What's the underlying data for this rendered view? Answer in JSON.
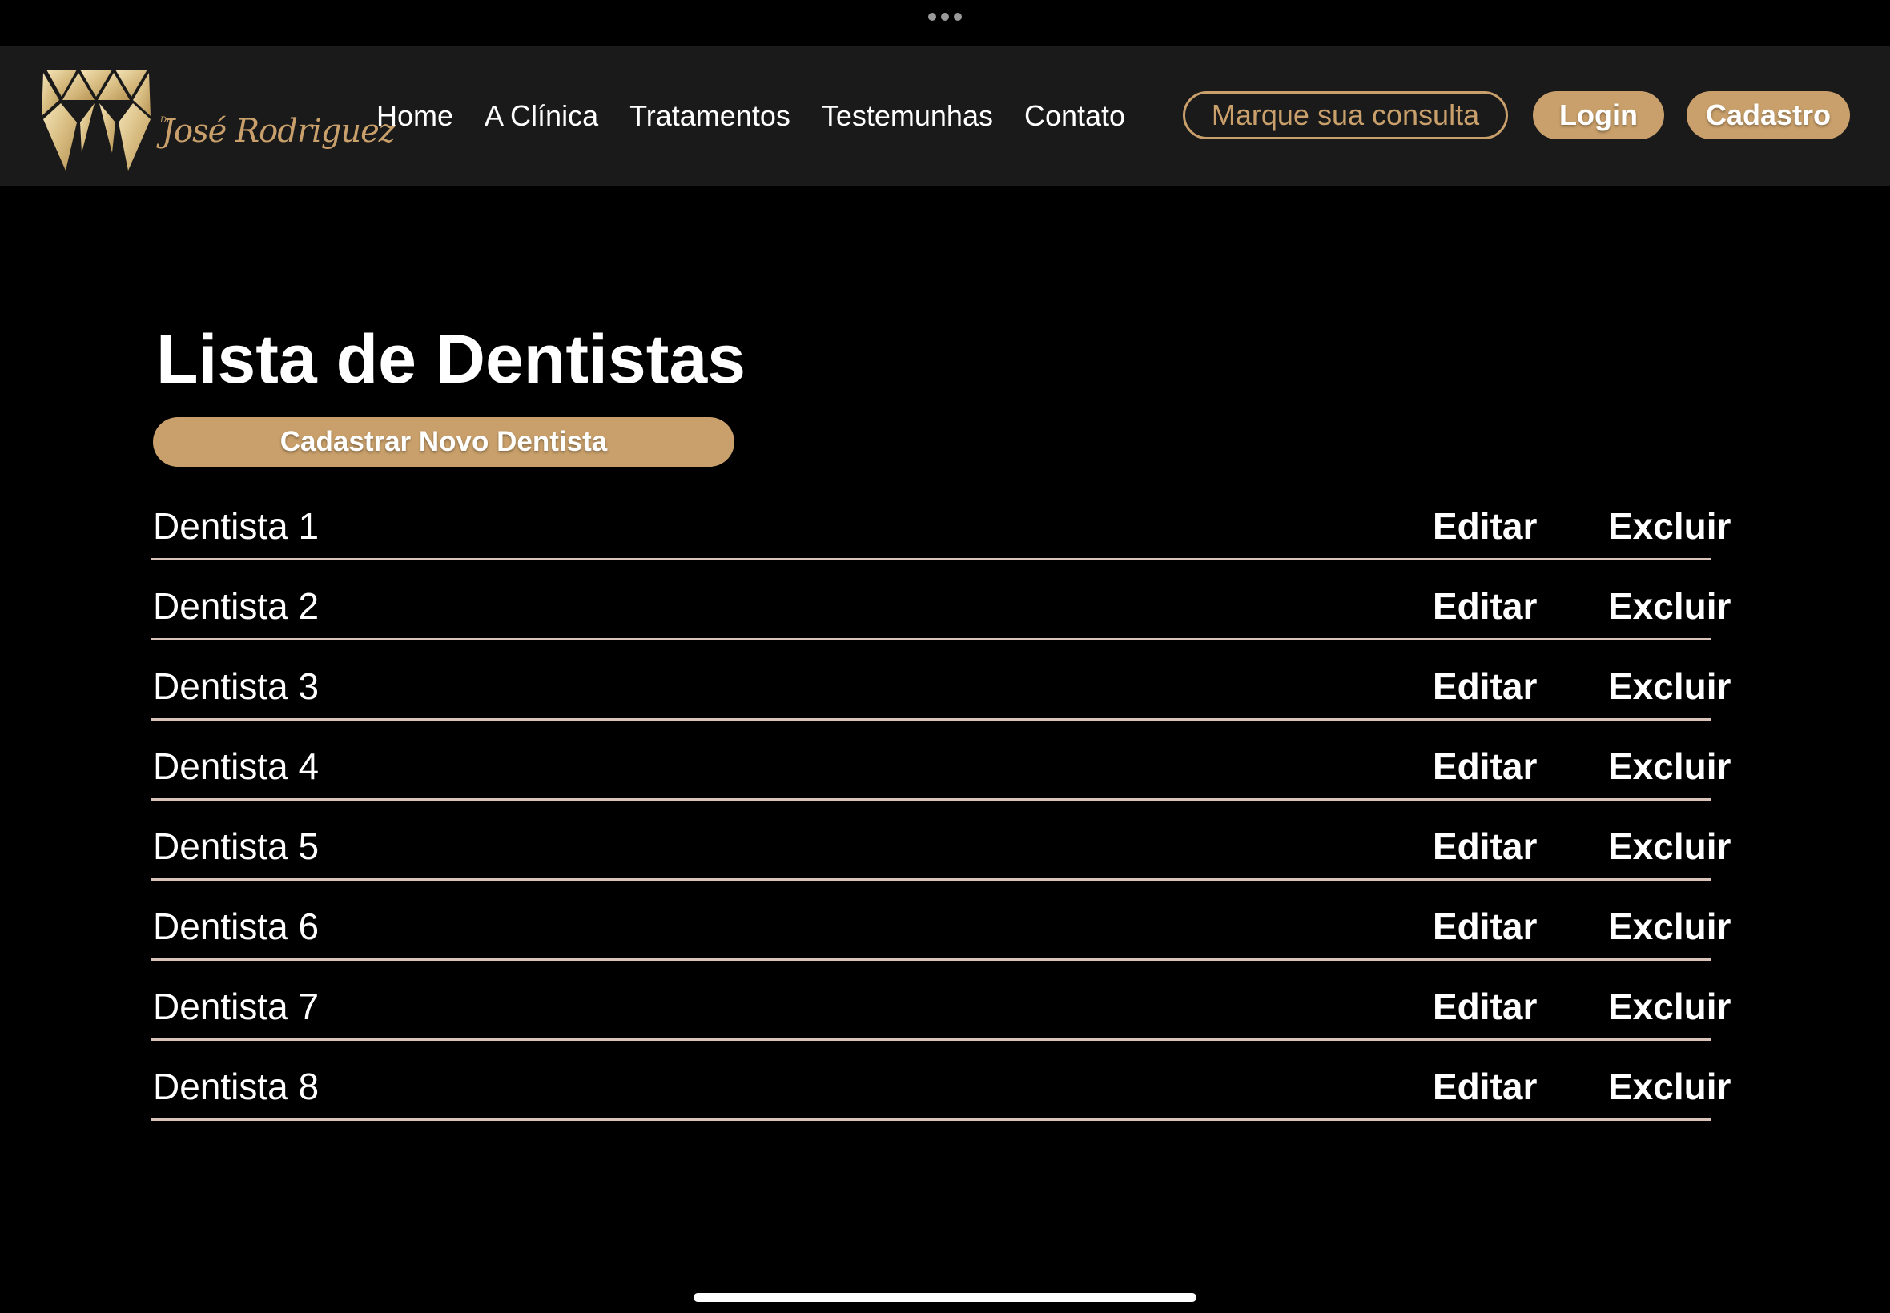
{
  "brand": {
    "prefix": "Dr.",
    "name": "José Rodriguez",
    "accent_color": "#c9a06b"
  },
  "nav": {
    "links": [
      {
        "label": "Home"
      },
      {
        "label": "A Clínica"
      },
      {
        "label": "Tratamentos"
      },
      {
        "label": "Testemunhas"
      },
      {
        "label": "Contato"
      }
    ],
    "appointment_label": "Marque sua consulta",
    "login_label": "Login",
    "signup_label": "Cadastro"
  },
  "main": {
    "title": "Lista de Dentistas",
    "new_button_label": "Cadastrar Novo Dentista",
    "edit_label": "Editar",
    "delete_label": "Excluir",
    "dentists": [
      {
        "name": "Dentista 1"
      },
      {
        "name": "Dentista 2"
      },
      {
        "name": "Dentista 3"
      },
      {
        "name": "Dentista 4"
      },
      {
        "name": "Dentista 5"
      },
      {
        "name": "Dentista 6"
      },
      {
        "name": "Dentista 7"
      },
      {
        "name": "Dentista 8"
      }
    ]
  }
}
